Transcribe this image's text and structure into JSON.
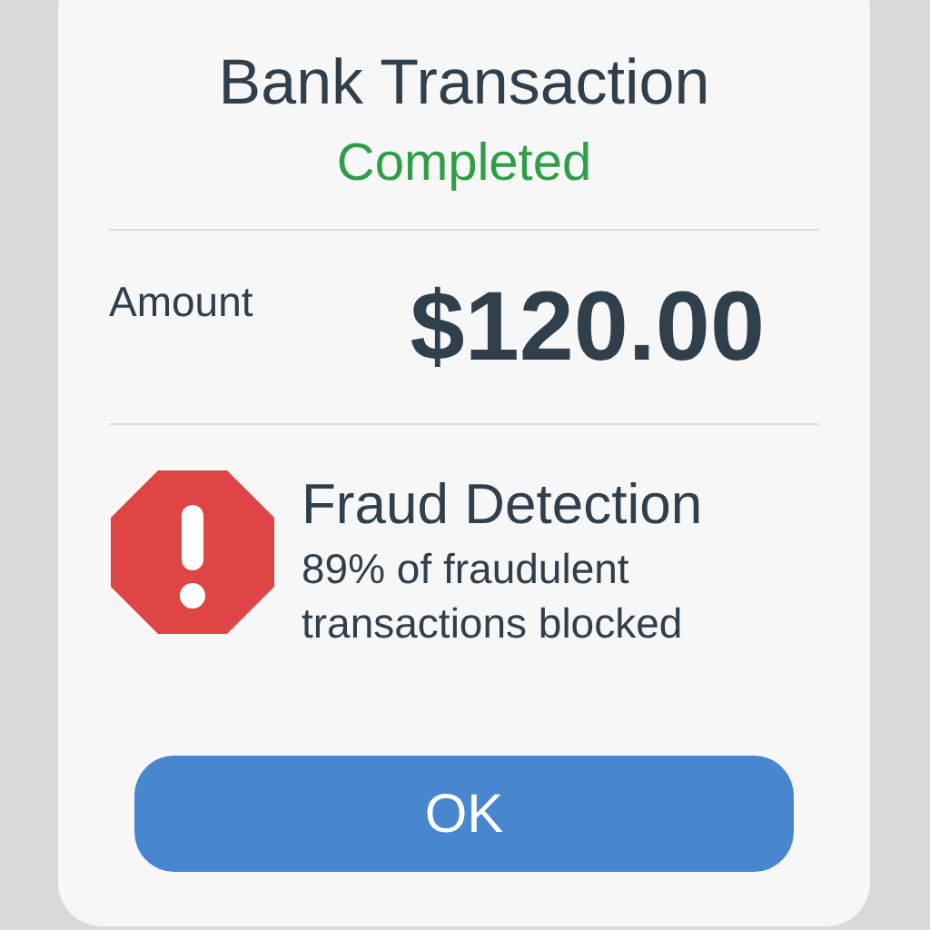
{
  "title": "Bank Transaction",
  "status": {
    "label": "Completed",
    "kind": "completed"
  },
  "amount": {
    "label": "Amount",
    "value": "$120.00"
  },
  "alert": {
    "kind": "warning",
    "title": "Fraud Detection",
    "message": "89% of fraudulent transactions blocked"
  },
  "button": {
    "label": "OK"
  }
}
